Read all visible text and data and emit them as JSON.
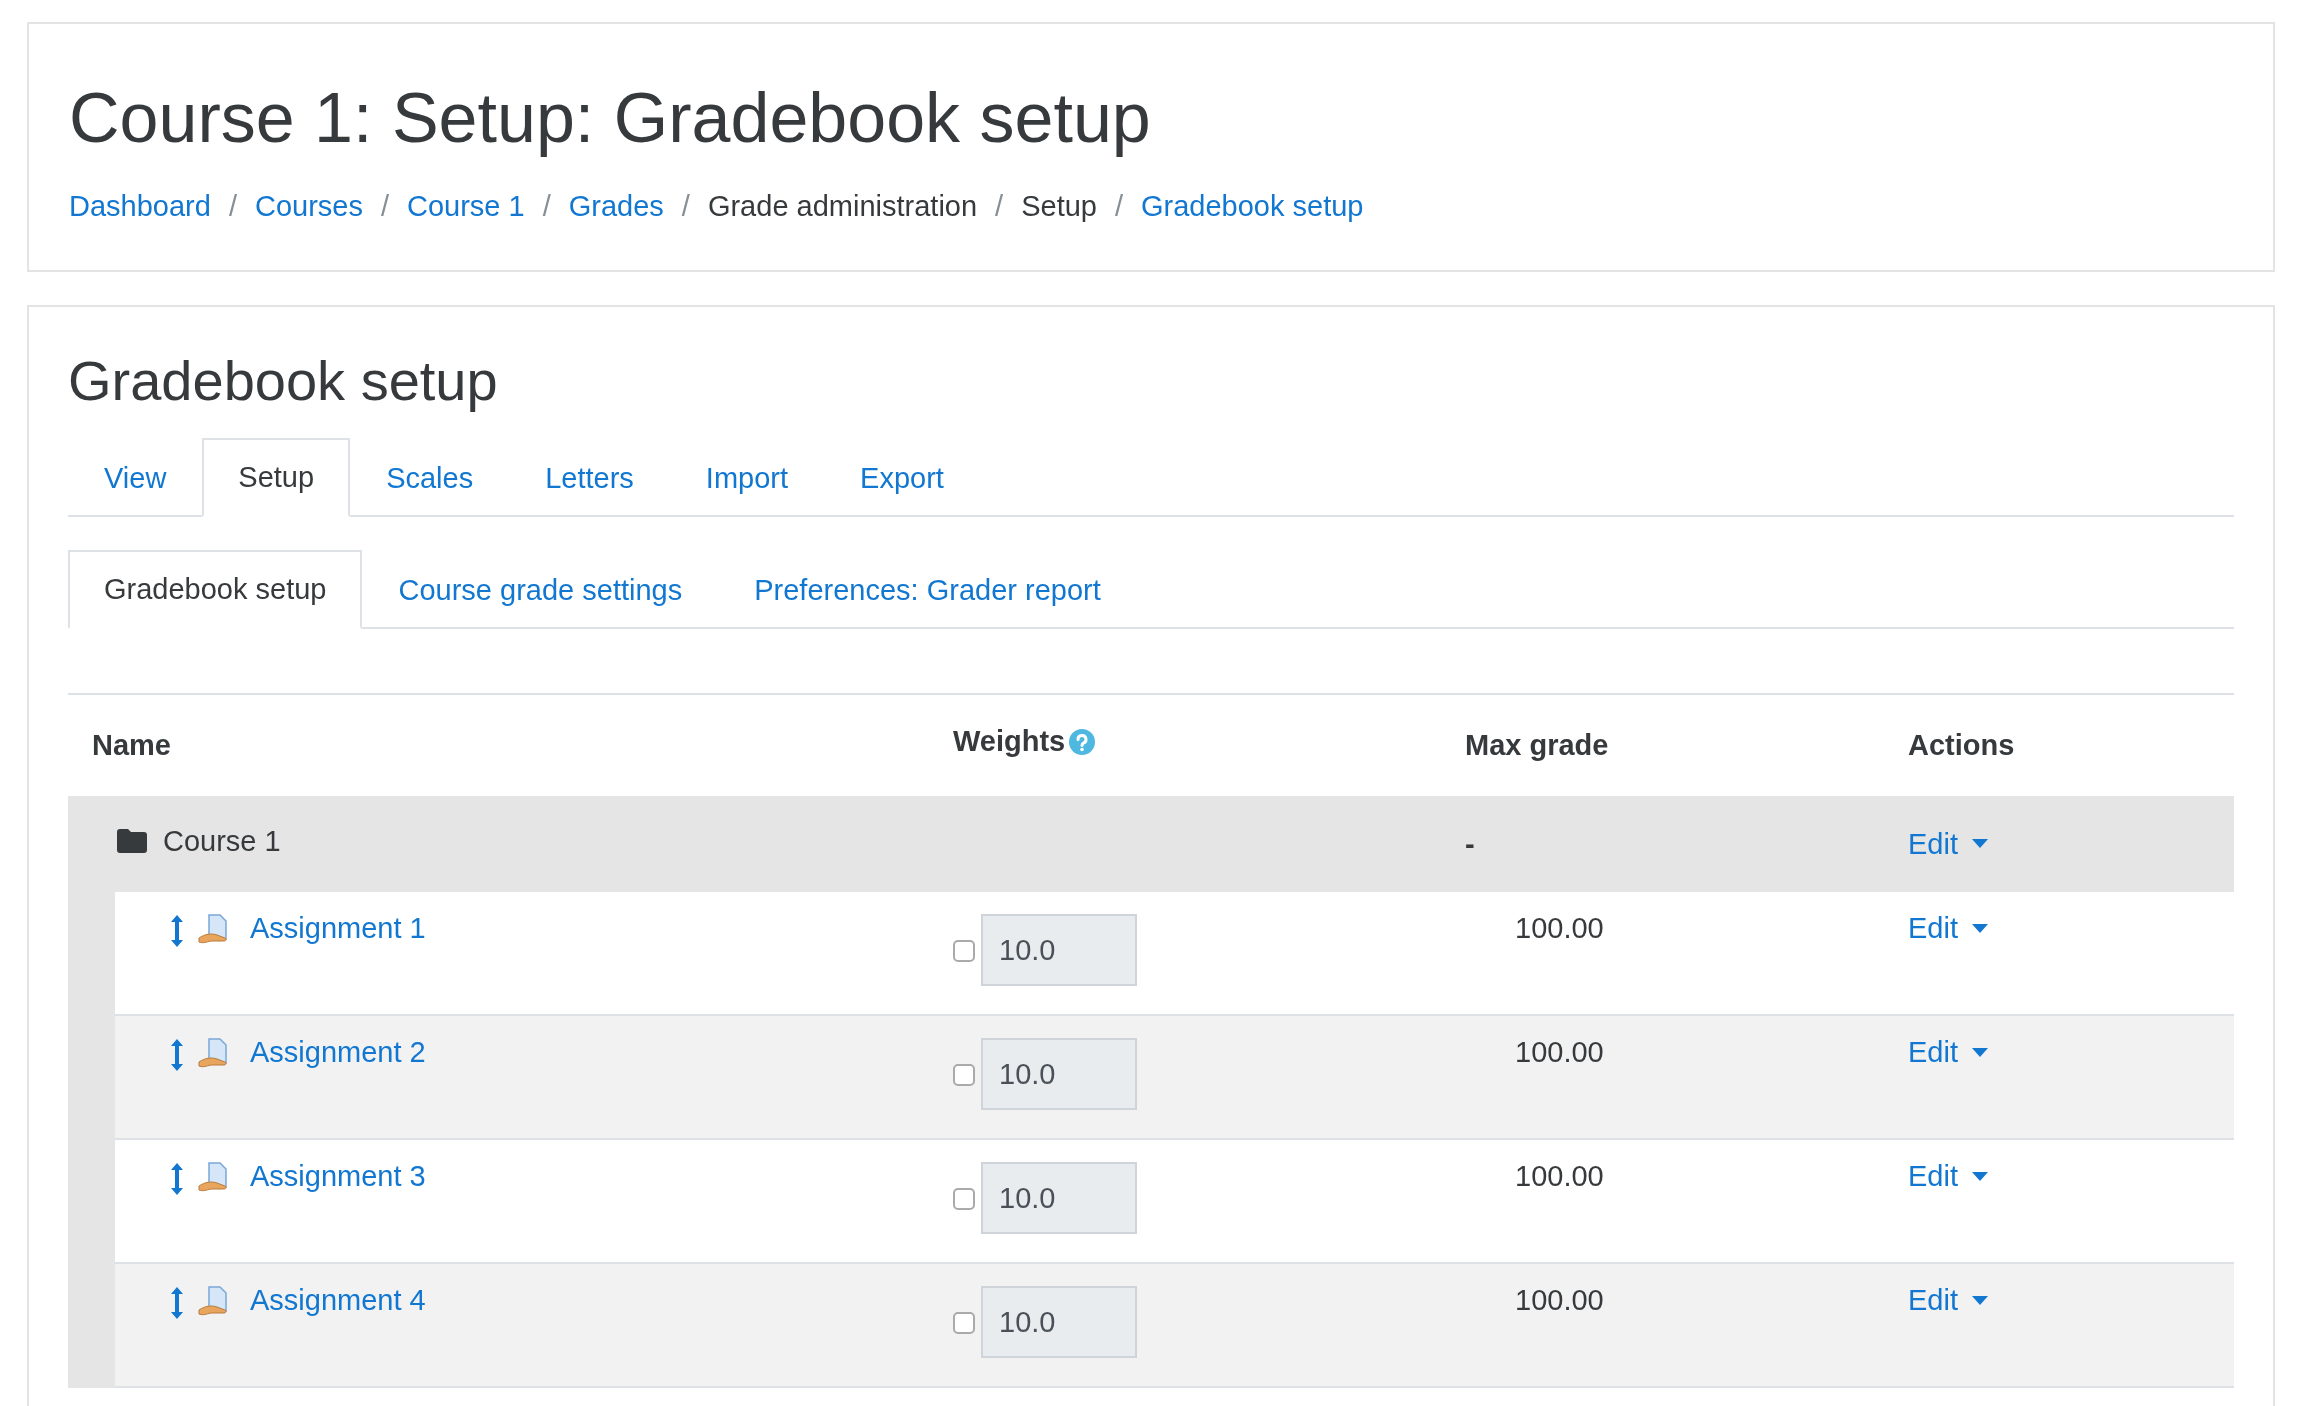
{
  "page_header": {
    "title": "Course 1: Setup: Gradebook setup",
    "separator": "/",
    "breadcrumb": [
      {
        "label": "Dashboard",
        "link": true
      },
      {
        "label": "Courses",
        "link": true
      },
      {
        "label": "Course 1",
        "link": true
      },
      {
        "label": "Grades",
        "link": true
      },
      {
        "label": "Grade administration",
        "link": false
      },
      {
        "label": "Setup",
        "link": false
      },
      {
        "label": "Gradebook setup",
        "link": true
      }
    ]
  },
  "heading": "Gradebook setup",
  "tabs": [
    {
      "label": "View",
      "selected": false
    },
    {
      "label": "Setup",
      "selected": true
    },
    {
      "label": "Scales",
      "selected": false
    },
    {
      "label": "Letters",
      "selected": false
    },
    {
      "label": "Import",
      "selected": false
    },
    {
      "label": "Export",
      "selected": false
    }
  ],
  "subtabs": [
    {
      "label": "Gradebook setup",
      "selected": true
    },
    {
      "label": "Course grade settings",
      "selected": false
    },
    {
      "label": "Preferences: Grader report",
      "selected": false
    }
  ],
  "table": {
    "columns": [
      "Name",
      "Weights",
      "Max grade",
      "Actions"
    ],
    "category": {
      "name": "Course 1",
      "max_grade": "-",
      "action": "Edit"
    },
    "rows": [
      {
        "name": "Assignment 1",
        "weight_override": false,
        "weight": "10.0",
        "max_grade": "100.00",
        "action": "Edit"
      },
      {
        "name": "Assignment 2",
        "weight_override": false,
        "weight": "10.0",
        "max_grade": "100.00",
        "action": "Edit"
      },
      {
        "name": "Assignment 3",
        "weight_override": false,
        "weight": "10.0",
        "max_grade": "100.00",
        "action": "Edit"
      },
      {
        "name": "Assignment 4",
        "weight_override": false,
        "weight": "10.0",
        "max_grade": "100.00",
        "action": "Edit"
      }
    ]
  }
}
